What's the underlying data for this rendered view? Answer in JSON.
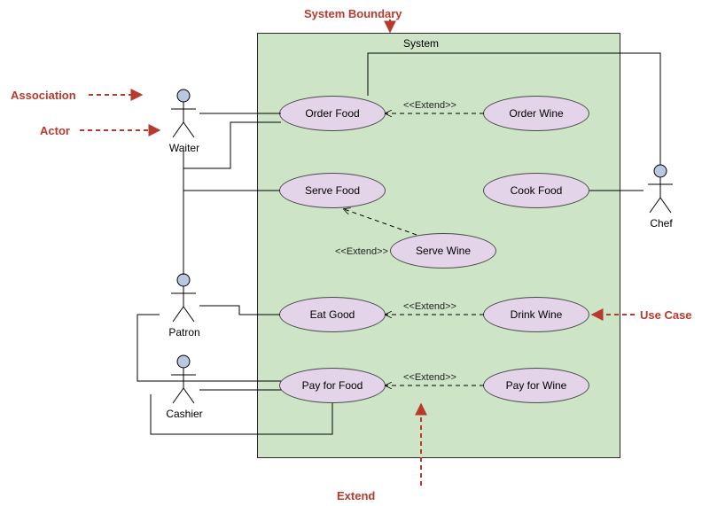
{
  "annotations": {
    "systemBoundary": "System Boundary",
    "association": "Association",
    "actor": "Actor",
    "useCase": "Use Case",
    "extend": "Extend"
  },
  "system": {
    "label": "System"
  },
  "actors": {
    "waiter": {
      "name": "Waiter"
    },
    "patron": {
      "name": "Patron"
    },
    "cashier": {
      "name": "Cashier"
    },
    "chef": {
      "name": "Chef"
    }
  },
  "useCases": {
    "orderFood": {
      "label": "Order Food"
    },
    "orderWine": {
      "label": "Order Wine"
    },
    "serveFood": {
      "label": "Serve Food"
    },
    "cookFood": {
      "label": "Cook Food"
    },
    "serveWine": {
      "label": "Serve Wine"
    },
    "eatGood": {
      "label": "Eat Good"
    },
    "drinkWine": {
      "label": "Drink Wine"
    },
    "payForFood": {
      "label": "Pay for Food"
    },
    "payForWine": {
      "label": "Pay for Wine"
    }
  },
  "relations": {
    "extendStereo": "<<Extend>>"
  },
  "colors": {
    "annotation": "#b83a2e",
    "systemFill": "#cde4c7",
    "useCaseFill": "#e4d4ea",
    "actorHead": "#b8c8e0"
  },
  "chart_data": {
    "type": "uml-use-case",
    "system": "System",
    "actors": [
      "Waiter",
      "Patron",
      "Cashier",
      "Chef"
    ],
    "use_cases": [
      "Order Food",
      "Order Wine",
      "Serve Food",
      "Cook Food",
      "Serve Wine",
      "Eat Good",
      "Drink Wine",
      "Pay for Food",
      "Pay for Wine"
    ],
    "associations": [
      [
        "Waiter",
        "Order Food"
      ],
      [
        "Waiter",
        "Serve Food"
      ],
      [
        "Patron",
        "Order Food"
      ],
      [
        "Patron",
        "Eat Good"
      ],
      [
        "Patron",
        "Pay for Food"
      ],
      [
        "Cashier",
        "Pay for Food"
      ],
      [
        "Chef",
        "Order Food"
      ],
      [
        "Chef",
        "Cook Food"
      ]
    ],
    "extends": [
      [
        "Order Wine",
        "Order Food"
      ],
      [
        "Serve Wine",
        "Serve Food"
      ],
      [
        "Drink Wine",
        "Eat Good"
      ],
      [
        "Pay for Wine",
        "Pay for Food"
      ]
    ],
    "legend_labels": [
      "System Boundary",
      "Association",
      "Actor",
      "Use Case",
      "Extend"
    ]
  }
}
